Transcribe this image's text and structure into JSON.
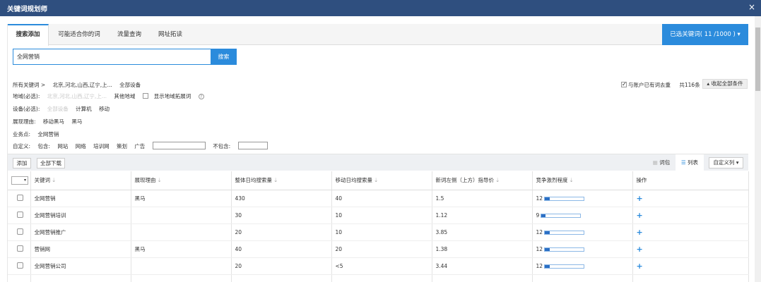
{
  "window": {
    "title": "关键词规划师",
    "close": "×"
  },
  "tabs": [
    "搜索添加",
    "可能适合你的词",
    "流量查询",
    "网址拓读"
  ],
  "selected_btn": "已选关键词( 11 /1000 ) ▾",
  "search": {
    "value": "全网营销",
    "button": "搜索"
  },
  "filters": {
    "row1": {
      "label": "所有关键词 >",
      "regions": "北京,河北,山西,辽宁,上...",
      "devices": "全部设备"
    },
    "row2": {
      "label": "地域(必选):",
      "regions": "北京,河北,山西,辽宁,上...",
      "other": "其他地域",
      "show": "显示地域拓展词"
    },
    "row3": {
      "label": "设备(必选):",
      "all": "全部设备",
      "pc": "计算机",
      "mobile": "移动"
    },
    "row4": {
      "label": "展现理由:",
      "opt1": "移动黑马",
      "opt2": "黑马"
    },
    "row5": {
      "label": "业务点:",
      "opt1": "全网营销"
    },
    "row6": {
      "label": "自定义:",
      "include": "包含:",
      "opt1": "网站",
      "opt2": "网络",
      "opt3": "培训网",
      "opt4": "策划",
      "opt5": "广告",
      "exclude": "不包含:"
    },
    "dedupe": "与账户已有词去重",
    "total": "共116条",
    "collapse": "▴ 收起全部条件"
  },
  "toolbar": {
    "add": "添加",
    "download": "全部下载",
    "view_bundle": "词包",
    "view_list": "列表",
    "custom_col": "自定义列 ▾"
  },
  "table": {
    "headers": [
      "关键词",
      "展现理由",
      "整体日均搜索量",
      "移动日均搜索量",
      "新词左侧（上方）指导价",
      "竞争激烈程度",
      "操作"
    ],
    "rows": [
      {
        "keyword": "全网营销",
        "reason": "黑马",
        "total": "430",
        "mobile": "40",
        "price": "1.5",
        "compete": "12",
        "level": 0.12
      },
      {
        "keyword": "全网营销培训",
        "reason": "",
        "total": "30",
        "mobile": "10",
        "price": "1.12",
        "compete": "9",
        "level": 0.09
      },
      {
        "keyword": "全网营销推广",
        "reason": "",
        "total": "20",
        "mobile": "10",
        "price": "3.85",
        "compete": "12",
        "level": 0.12
      },
      {
        "keyword": "营销网",
        "reason": "黑马",
        "total": "40",
        "mobile": "20",
        "price": "1.38",
        "compete": "12",
        "level": 0.12
      },
      {
        "keyword": "全网营销公司",
        "reason": "",
        "total": "20",
        "mobile": "<5",
        "price": "3.44",
        "compete": "12",
        "level": 0.12
      }
    ],
    "plus": "+"
  },
  "colors": {
    "titlebar": "#2f4f7f",
    "accent": "#2b8bdc",
    "bar": "#2b6fc4"
  }
}
